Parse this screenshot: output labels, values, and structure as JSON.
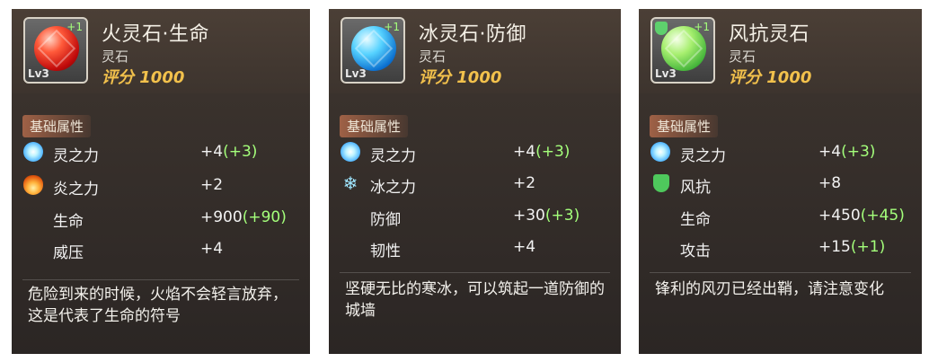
{
  "cards": [
    {
      "title": "火灵石·生命",
      "subtitle": "灵石",
      "score": "评分 1000",
      "level": "Lv3",
      "plus": "+1",
      "section": "基础属性",
      "stats": [
        {
          "icon": "spirit-icon",
          "name": "灵之力",
          "value": "+4",
          "bonus": "(+3)"
        },
        {
          "icon": "flame-icon",
          "name": "炎之力",
          "value": "+2",
          "bonus": ""
        },
        {
          "icon": "",
          "name": "生命",
          "value": "+900",
          "bonus": "(+90)"
        },
        {
          "icon": "",
          "name": "威压",
          "value": "+4",
          "bonus": ""
        }
      ],
      "description": "危险到来的时候，火焰不会轻言放弃，这是代表了生命的符号"
    },
    {
      "title": "冰灵石·防御",
      "subtitle": "灵石",
      "score": "评分 1000",
      "level": "Lv3",
      "plus": "+1",
      "section": "基础属性",
      "stats": [
        {
          "icon": "spirit-icon",
          "name": "灵之力",
          "value": "+4",
          "bonus": "(+3)"
        },
        {
          "icon": "snowflake-icon",
          "name": "冰之力",
          "value": "+2",
          "bonus": ""
        },
        {
          "icon": "",
          "name": "防御",
          "value": "+30",
          "bonus": "(+3)"
        },
        {
          "icon": "",
          "name": "韧性",
          "value": "+4",
          "bonus": ""
        }
      ],
      "description": "坚硬无比的寒冰，可以筑起一道防御的城墙"
    },
    {
      "title": "风抗灵石",
      "subtitle": "灵石",
      "score": "评分 1000",
      "level": "Lv3",
      "plus": "+1",
      "section": "基础属性",
      "stats": [
        {
          "icon": "spirit-icon",
          "name": "灵之力",
          "value": "+4",
          "bonus": "(+3)"
        },
        {
          "icon": "shield-icon",
          "name": "风抗",
          "value": "+8",
          "bonus": ""
        },
        {
          "icon": "",
          "name": "生命",
          "value": "+450",
          "bonus": "(+45)"
        },
        {
          "icon": "",
          "name": "攻击",
          "value": "+15",
          "bonus": "(+1)"
        }
      ],
      "description": "锋利的风刃已经出鞘，请注意变化"
    }
  ]
}
